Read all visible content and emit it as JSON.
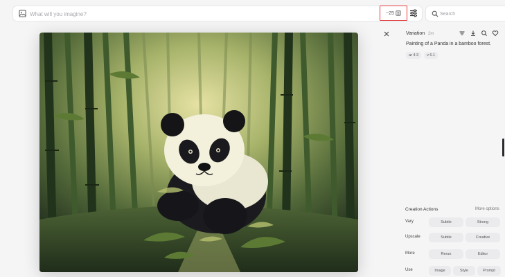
{
  "prompt_bar": {
    "placeholder": "What will you imagine?",
    "cost": "~25"
  },
  "search": {
    "placeholder": "Search"
  },
  "image": {
    "alt": "Painting of a Panda in a bamboo forest."
  },
  "panel": {
    "title": "Variation",
    "time": "2m",
    "prompt": "Painting of a Panda in a bamboo forest.",
    "params": [
      "ar 4:3",
      "v 6.1"
    ]
  },
  "creation_actions": {
    "title": "Creation Actions",
    "more_options": "More options",
    "rows": [
      {
        "label": "Vary",
        "buttons": [
          "Subtle",
          "Strong"
        ]
      },
      {
        "label": "Upscale",
        "buttons": [
          "Subtle",
          "Creative"
        ]
      },
      {
        "label": "More",
        "buttons": [
          "Rerun",
          "Editor"
        ]
      },
      {
        "label": "Use",
        "buttons": [
          "Image",
          "Style",
          "Prompt"
        ]
      }
    ]
  },
  "colors": {
    "accent_red": "#e23a3a",
    "background": "#f5f5f6",
    "button_bg": "#ebebee"
  }
}
